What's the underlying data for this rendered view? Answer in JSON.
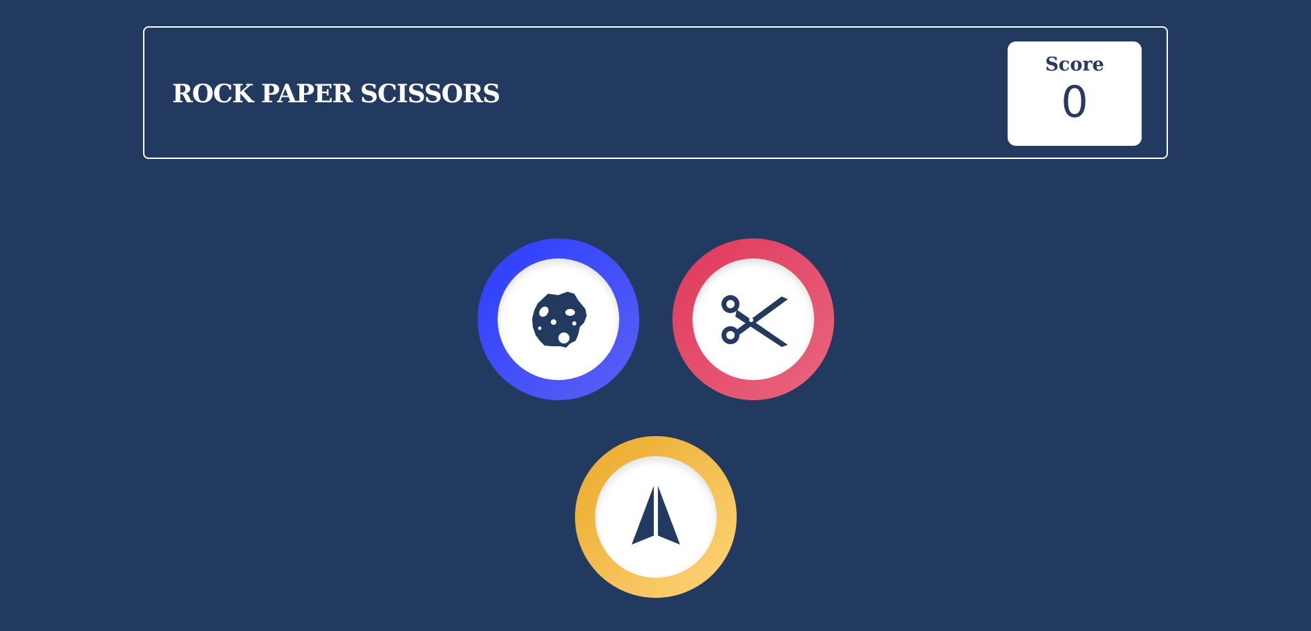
{
  "header": {
    "title": "ROCK PAPER SCISSORS",
    "score_label": "Score",
    "score_value": "0"
  },
  "choices": [
    {
      "id": "rock",
      "icon": "rock-icon",
      "color": "#3b4dfb"
    },
    {
      "id": "scissors",
      "icon": "scissors-icon",
      "color": "#e3415f"
    },
    {
      "id": "paper",
      "icon": "paper-plane-icon",
      "color": "#f2b53b"
    }
  ],
  "colors": {
    "background": "#233a60",
    "border": "#ffffff",
    "icon": "#233a60"
  }
}
